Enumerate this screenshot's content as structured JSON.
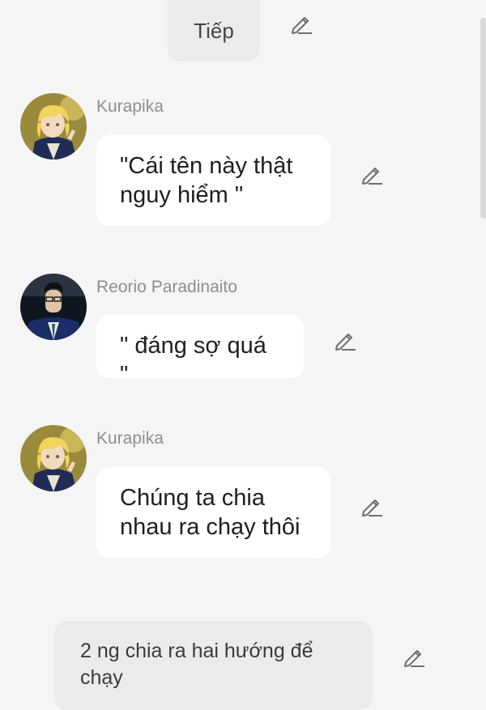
{
  "top_button": {
    "label": "Tiếp"
  },
  "messages": [
    {
      "speaker": "Kurapika",
      "text": "\"Cái tên này thật nguy hiểm \"",
      "avatar": "kurapika-avatar"
    },
    {
      "speaker": "Reorio Paradinaito",
      "text": "\" đáng sợ quá \"",
      "avatar": "reorio-avatar"
    },
    {
      "speaker": "Kurapika",
      "text": "Chúng ta chia nhau ra chạy thôi",
      "avatar": "kurapika-avatar"
    }
  ],
  "narration": {
    "text": "2 ng chia ra hai hướng để chạy"
  },
  "icons": {
    "edit": "pencil-icon"
  },
  "colors": {
    "background": "#f5f5f5",
    "bubble": "#ffffff",
    "pill": "#ebebeb",
    "name_text": "#8e8e8e",
    "icon": "#6f6f6f"
  }
}
